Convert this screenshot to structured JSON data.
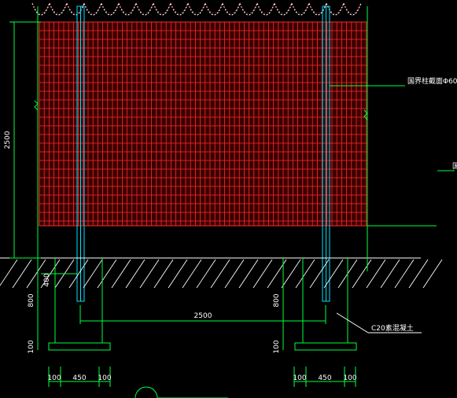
{
  "drawing": {
    "colors": {
      "background": "#000000",
      "mesh": "#ff2a2a",
      "dimension_lines": "#00ff3c",
      "posts": "#00e5ff",
      "hatch": "#ffffff",
      "razor_wire": "#ffffff",
      "razor_wire_accent": "#ff3030",
      "text": "#ffffff"
    },
    "dimensions": {
      "fence_height": "2500",
      "post_spacing": "2500",
      "post_embed_left": "400",
      "footing_depth_left": "800",
      "footing_depth_right": "800",
      "footing_pad_left": "100",
      "footing_pad_right": "100",
      "footing_width_left": "450",
      "footing_width_right": "450",
      "footing_edge_left_a": "100",
      "footing_edge_left_b": "100",
      "footing_edge_right_a": "100",
      "footing_edge_right_b": "100"
    },
    "labels": {
      "post_note": "国界柱截面Φ60",
      "concrete_note": "C20素混凝土",
      "edge_fragment": "国"
    },
    "icons": {
      "razor_wire": "razor-wire-coil",
      "break_symbol": "break-line-icon",
      "ground": "ground-hatch"
    }
  }
}
